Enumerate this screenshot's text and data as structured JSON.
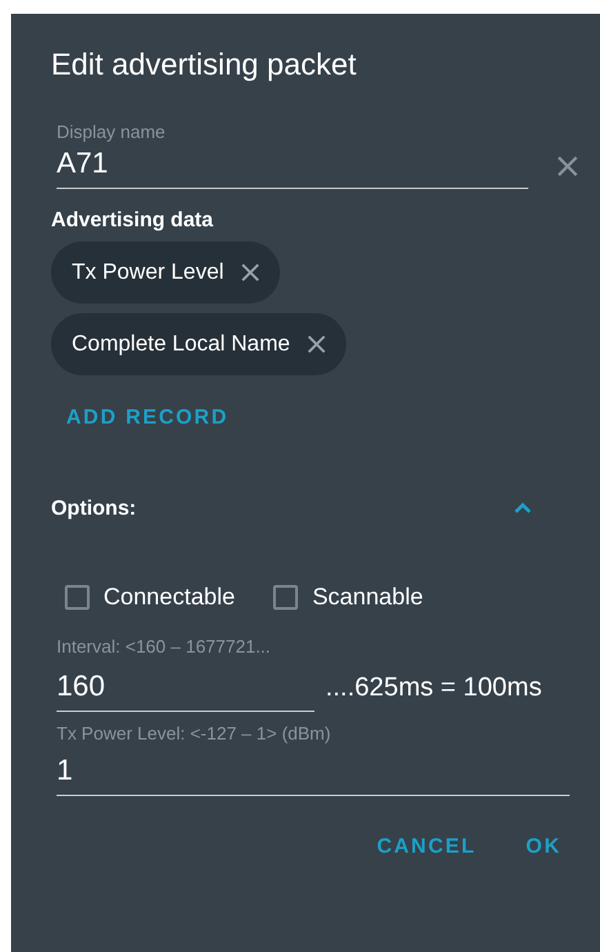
{
  "dialog": {
    "title": "Edit advertising packet",
    "display_name": {
      "label": "Display name",
      "value": "A71"
    },
    "advertising_data": {
      "heading": "Advertising data",
      "records": [
        {
          "label": "Tx Power Level"
        },
        {
          "label": "Complete Local Name"
        }
      ],
      "add_button": "ADD RECORD"
    },
    "options": {
      "heading": "Options:",
      "expanded": true,
      "checkboxes": [
        {
          "label": "Connectable",
          "checked": false
        },
        {
          "label": "Scannable",
          "checked": false
        }
      ],
      "interval": {
        "label": "Interval: <160 – 1677721...",
        "value": "160",
        "suffix": "....625ms = 100ms"
      },
      "tx_power": {
        "label": "Tx Power Level: <-127 – 1> (dBm)",
        "value": "1"
      }
    },
    "buttons": [
      "CANCEL",
      "OK"
    ]
  }
}
